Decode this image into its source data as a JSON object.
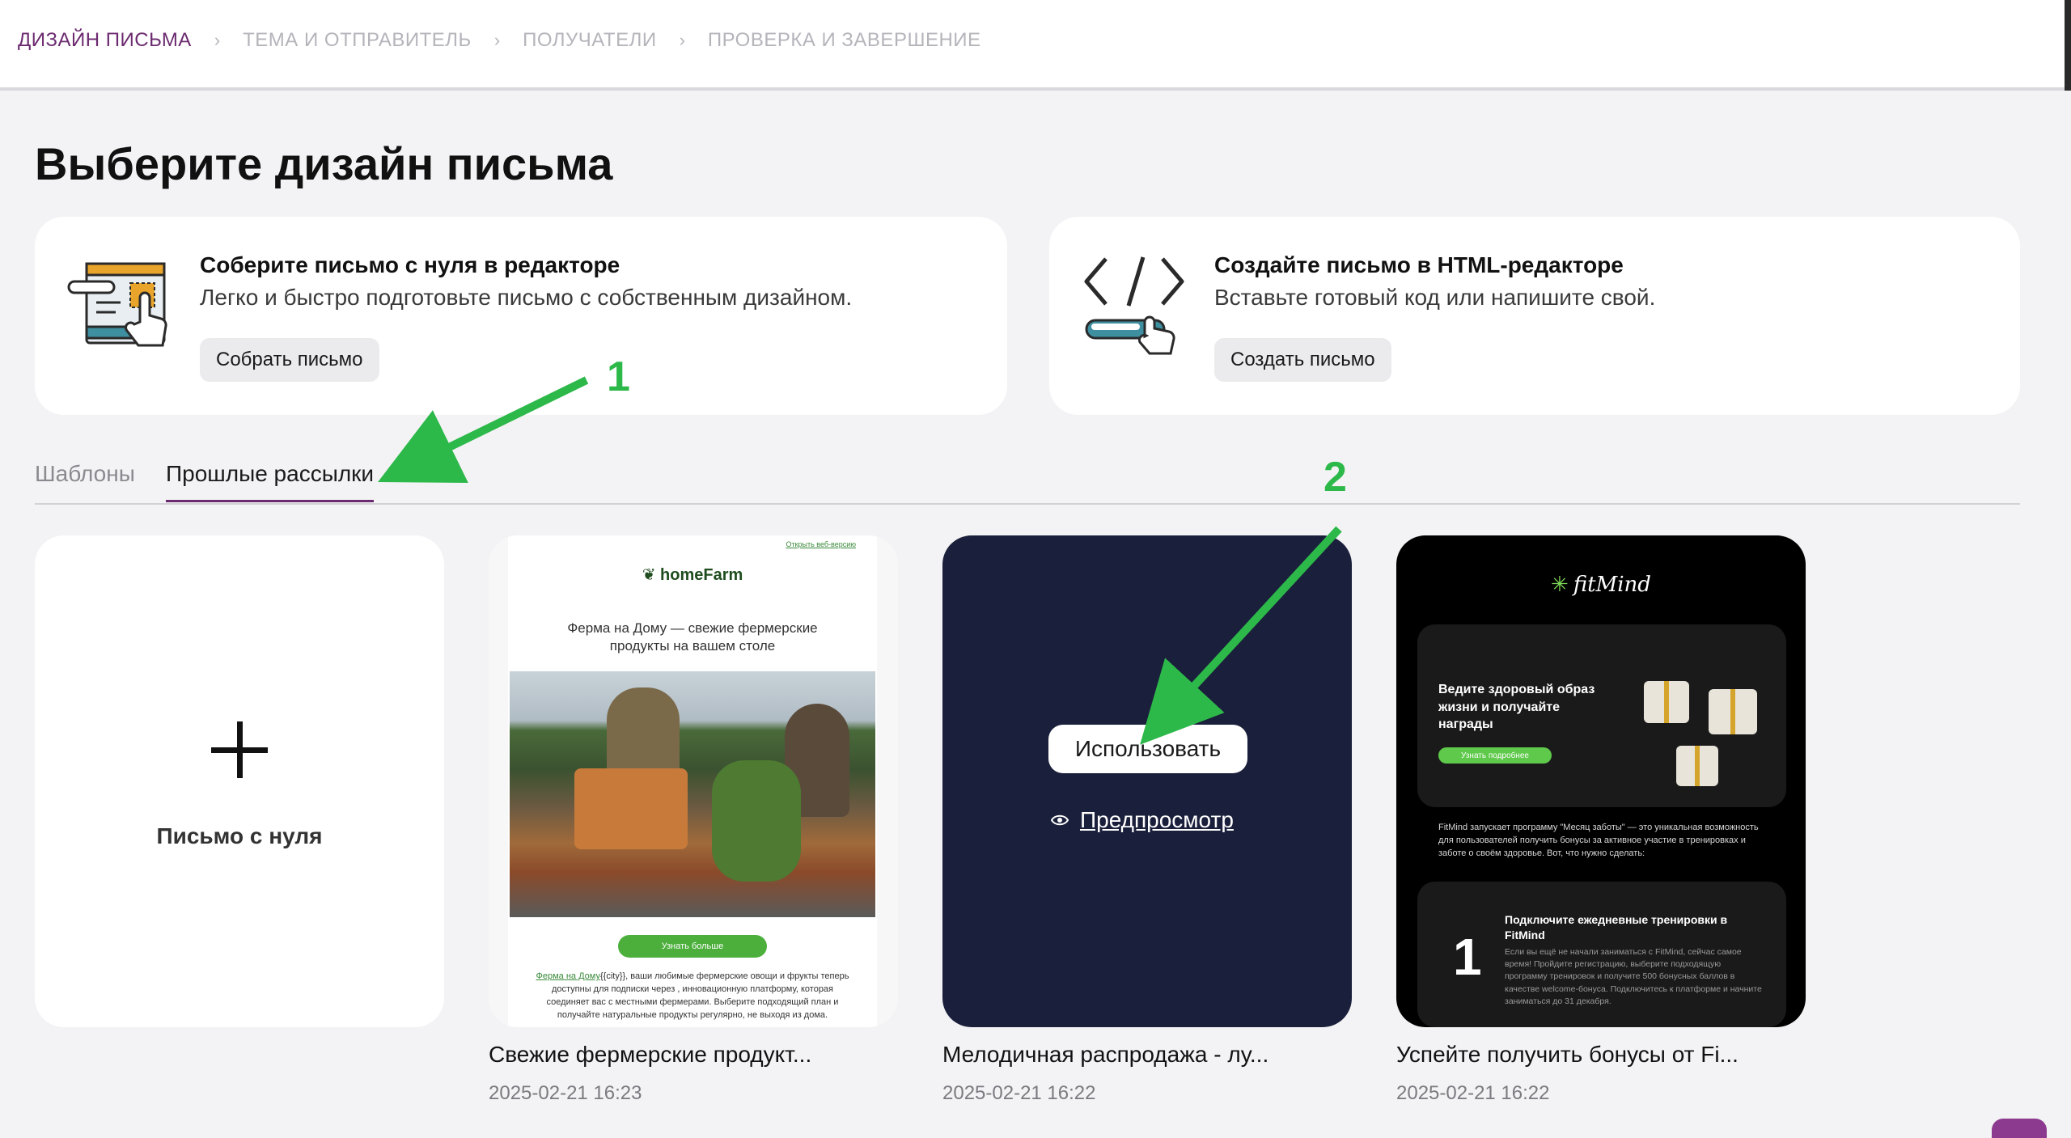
{
  "breadcrumb": {
    "steps": [
      "ДИЗАЙН ПИСЬМА",
      "ТЕМА И ОТПРАВИТЕЛЬ",
      "ПОЛУЧАТЕЛИ",
      "ПРОВЕРКА И ЗАВЕРШЕНИЕ"
    ],
    "separator": "›"
  },
  "page": {
    "title": "Выберите дизайн письма"
  },
  "create_cards": [
    {
      "title": "Соберите письмо с нуля в редакторе",
      "description": "Легко и быстро подготовьте письмо с собственным дизайном.",
      "button": "Собрать письмо",
      "icon": "layout-editor-icon"
    },
    {
      "title": "Создайте письмо в HTML-редакторе",
      "description": "Вставьте готовый код или напишите свой.",
      "button": "Создать письмо",
      "icon": "code-editor-icon"
    }
  ],
  "tabs": [
    {
      "label": "Шаблоны",
      "active": false
    },
    {
      "label": "Прошлые рассылки",
      "active": true
    }
  ],
  "blank_card": {
    "label": "Письмо с нуля",
    "icon": "plus-icon"
  },
  "templates": [
    {
      "name": "Свежие фермерские продукт...",
      "date": "2025-02-21 16:23",
      "preview": {
        "top_link": "Открыть веб-версию",
        "logo": "homeFarm",
        "headline": "Ферма на Дому — свежие фермерские продукты на вашем столе",
        "button": "Узнать больше",
        "link_text": "Ферма на Дому",
        "body": "{{city}}, ваши любимые фермерские овощи и фрукты теперь доступны для подписки через , инновационную платформу, которая соединяет вас с местными фермерами. Выберите подходящий план и получайте натуральные продукты регулярно, не выходя из дома."
      }
    },
    {
      "name": "Мелодичная распродажа - лу...",
      "date": "2025-02-21 16:22",
      "hover": {
        "use_button": "Использовать",
        "preview_link": "Предпросмотр",
        "preview_icon": "eye-icon"
      }
    },
    {
      "name": "Успейте получить бонусы от Fi...",
      "date": "2025-02-21 16:22",
      "preview": {
        "logo": "fitMind",
        "hero_text": "Ведите здоровый образ жизни и получайте награды",
        "hero_button": "Узнать подробнее",
        "paragraph": "FitMind запускает программу \"Месяц заботы\" — это уникальная возможность для пользователей получить бонусы за активное участие в тренировках и заботе о своём здоровье. Вот, что нужно сделать:",
        "step_number": "1",
        "step_title": "Подключите ежедневные тренировки в FitMind",
        "step_text": "Если вы ещё не начали заниматься с FitMind, сейчас самое время! Пройдите регистрацию, выберите подходящую программу тренировок и получите 500 бонусных баллов в качестве welcome-бонуса. Подключитесь к платформе и начните заниматься до 31 декабря."
      }
    }
  ],
  "annotations": {
    "marker_1": "1",
    "marker_2": "2",
    "color": "#2db84a"
  },
  "colors": {
    "accent": "#6b2a6f",
    "dark_card": "#1a1f3b",
    "green": "#4caf3c"
  }
}
